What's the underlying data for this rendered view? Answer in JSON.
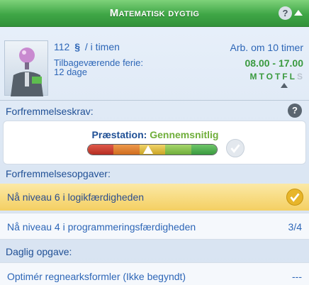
{
  "header": {
    "title": "Matematisk dygtig",
    "help": "?"
  },
  "career": {
    "salary": "112",
    "salary_symbol": "§",
    "salary_unit": "/ i timen",
    "vacation_label": "Tilbageværende ferie:",
    "vacation_value": "12 dage",
    "work_in": "Arb. om 10 timer",
    "hours": "08.00 - 17.00",
    "days": [
      {
        "label": "M",
        "active": true
      },
      {
        "label": "T",
        "active": true
      },
      {
        "label": "O",
        "active": true
      },
      {
        "label": "T",
        "active": true
      },
      {
        "label": "F",
        "active": true
      },
      {
        "label": "L",
        "active": true
      },
      {
        "label": "S",
        "active": false
      }
    ]
  },
  "promotion": {
    "requirements_label": "Forfremmelseskrav:",
    "performance_key": "Præstation:",
    "performance_value": "Gennemsnitlig",
    "tasks_label": "Forfremmelsesopgaver:",
    "tasks": [
      {
        "label": "Nå niveau 6 i logikfærdigheden",
        "progress": "",
        "done": true
      },
      {
        "label": "Nå niveau 4 i programmeringsfærdigheden",
        "progress": "3/4",
        "done": false
      }
    ]
  },
  "daily": {
    "label": "Daglig opgave:",
    "task": "Optimér regnearksformler (Ikke begyndt)",
    "progress": "---"
  },
  "colors": {
    "header_green": "#3fa646",
    "text_blue": "#2d66b7",
    "text_green": "#3a9a3f",
    "gold": "#f4cf62"
  }
}
